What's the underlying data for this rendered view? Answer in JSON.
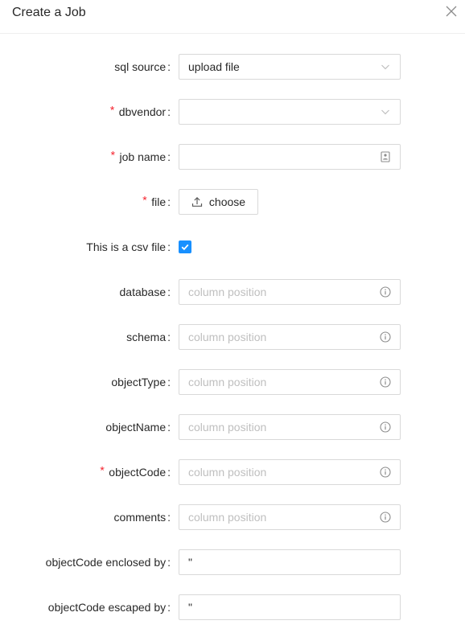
{
  "modal": {
    "title": "Create a Job"
  },
  "form": {
    "sql_source": {
      "label": "sql source",
      "value": "upload file"
    },
    "dbvendor": {
      "label": "dbvendor",
      "value": ""
    },
    "job_name": {
      "label": "job name",
      "value": ""
    },
    "file": {
      "label": "file",
      "button_label": "choose"
    },
    "csv": {
      "label": "This is a csv file",
      "checked": true
    },
    "database": {
      "label": "database",
      "placeholder": "column position"
    },
    "schema": {
      "label": "schema",
      "placeholder": "column position"
    },
    "object_type": {
      "label": "objectType",
      "placeholder": "column position"
    },
    "object_name": {
      "label": "objectName",
      "placeholder": "column position"
    },
    "object_code": {
      "label": "objectCode",
      "placeholder": "column position"
    },
    "comments": {
      "label": "comments",
      "placeholder": "column position"
    },
    "enclosed_by": {
      "label": "objectCode enclosed by",
      "value": "\""
    },
    "escaped_by": {
      "label": "objectCode escaped by",
      "value": "\""
    }
  },
  "colors": {
    "required": "#f5222d",
    "checkbox": "#1890ff",
    "placeholder": "#bfbfbf",
    "border": "#d9d9d9"
  },
  "icons": {
    "close": "close-icon",
    "select_arrow": "chevron-down-icon",
    "contact_card": "contact-card-icon",
    "upload": "upload-icon",
    "check": "check-icon",
    "info": "info-circle-icon"
  }
}
